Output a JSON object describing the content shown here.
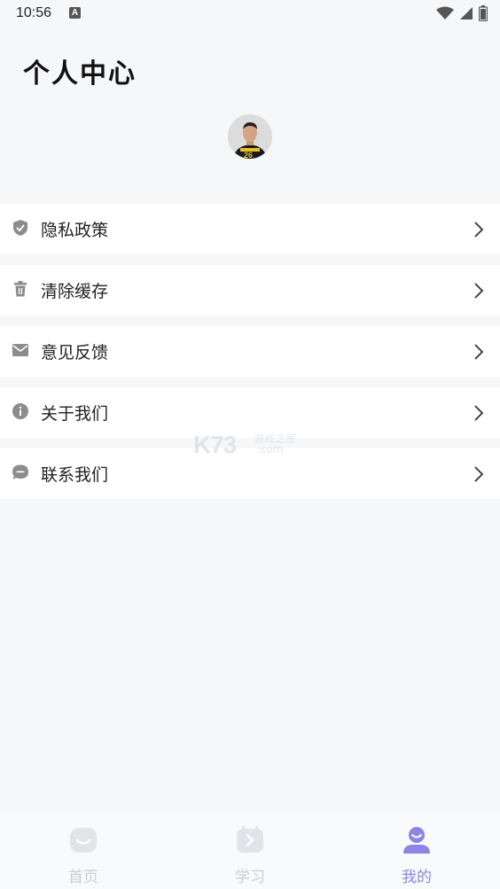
{
  "status_bar": {
    "time": "10:56",
    "notification": "A"
  },
  "page": {
    "title": "个人中心"
  },
  "menu": {
    "items": [
      {
        "label": "隐私政策",
        "icon": "shield-icon"
      },
      {
        "label": "清除缓存",
        "icon": "trash-icon"
      },
      {
        "label": "意见反馈",
        "icon": "mail-icon"
      },
      {
        "label": "关于我们",
        "icon": "info-icon"
      },
      {
        "label": "联系我们",
        "icon": "chat-icon"
      }
    ]
  },
  "watermark": {
    "brand": "K73",
    "line1": "游戏之家",
    "line2": ".com"
  },
  "bottom_nav": {
    "tabs": [
      {
        "label": "首页",
        "icon": "home-face-icon",
        "active": false
      },
      {
        "label": "学习",
        "icon": "study-icon",
        "active": false
      },
      {
        "label": "我的",
        "icon": "profile-icon",
        "active": true
      }
    ]
  },
  "colors": {
    "accent": "#8d85e6",
    "inactive": "#c9ccd2",
    "background": "#f6f7f9"
  }
}
